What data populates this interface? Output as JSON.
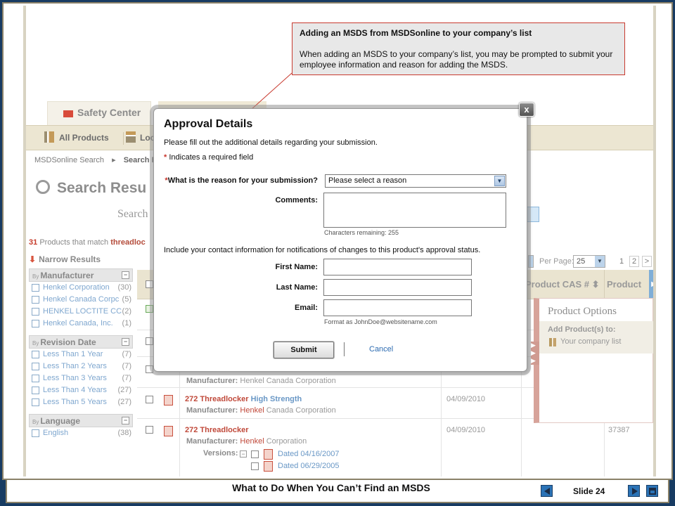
{
  "callout": {
    "title": "Adding an MSDS from MSDSonline to your company’s list",
    "body": "When adding an MSDS to your company’s list, you may be prompted to submit your employee information and reason  for adding the MSDS."
  },
  "site": {
    "safety_center_label": "Safety Center",
    "nav_all_products": "All Products",
    "nav_loc_partial": "Loc",
    "breadcrumb_first": "MSDSonline Search",
    "breadcrumb_second": "Search R",
    "search_title": "Search Resu",
    "search_sub": "Search",
    "result_count": "31",
    "result_text": "Products that match",
    "result_term": "threadloc",
    "narrow_results": "Narrow Results"
  },
  "filters": {
    "manufacturer": {
      "by": "By",
      "title": "Manufacturer",
      "items": [
        {
          "label": "Henkel Corporation",
          "count": "(30)"
        },
        {
          "label": "Henkel Canada Corpc",
          "count": "(5)"
        },
        {
          "label": "HENKEL LOCTITE CC",
          "count": "(2)"
        },
        {
          "label": "Henkel Canada, Inc.",
          "count": "(1)"
        }
      ]
    },
    "revision": {
      "by": "By",
      "title": "Revision Date",
      "items": [
        {
          "label": "Less Than 1 Year",
          "count": "(7)"
        },
        {
          "label": "Less Than 2 Years",
          "count": "(7)"
        },
        {
          "label": "Less Than 3 Years",
          "count": "(7)"
        },
        {
          "label": "Less Than 4 Years",
          "count": "(27)"
        },
        {
          "label": "Less Than 5 Years",
          "count": "(27)"
        }
      ]
    },
    "language": {
      "by": "By",
      "title": "Language",
      "items": [
        {
          "label": "English",
          "count": "(38)"
        }
      ]
    }
  },
  "table": {
    "col_cas": "Product CAS #",
    "col_product": "Product",
    "per_page_label": "Per Page:",
    "per_page_value": "25",
    "page_current": "1",
    "page_next": "2",
    "page_more": ">",
    "rows": [
      {
        "title": "272 Threadlocker",
        "title_suffix": "High Strength",
        "mfr_label": "Manufacturer:",
        "mfr_red": "Henkel",
        "mfr_rest": "Canada Corporation",
        "date": "04/09/2010",
        "cas": ""
      },
      {
        "title": "272 Threadlocker",
        "title_suffix": "",
        "mfr_label": "Manufacturer:",
        "mfr_red": "Henkel",
        "mfr_rest": "Corporation",
        "date": "04/09/2010",
        "cas": "37387"
      }
    ],
    "partial_mfr": "Manufacturer:",
    "partial_mfr_value": "Henkel Canada Corporation",
    "versions_label": "Versions:",
    "versions": [
      "Dated 04/16/2007",
      "Dated 06/29/2005"
    ]
  },
  "product_options": {
    "title": "Product Options",
    "add_to": "Add Product(s) to:",
    "company_list": "Your company list"
  },
  "modal": {
    "title": "Approval Details",
    "description": "Please fill out the additional details regarding your submission.",
    "required_star": "*",
    "required_text": "Indicates a required field",
    "reason_label": "What is the reason for your submission?",
    "reason_value": "Please select a reason",
    "comments_label": "Comments:",
    "chars_remaining": "Characters remaining: 255",
    "contact_text": "Include your contact information for notifications of changes to this product's approval status.",
    "first_name_label": "First Name:",
    "last_name_label": "Last Name:",
    "email_label": "Email:",
    "email_hint": "Format as JohnDoe@websitename.com",
    "submit_label": "Submit",
    "cancel_label": "Cancel",
    "close_label": "x"
  },
  "footer": {
    "title": "What to Do When You Can’t Find an MSDS",
    "slide_label": "Slide 24"
  },
  "colors": {
    "slide_background": "#173b62",
    "callout_border": "#c83a2f",
    "link": "#2c6bb1",
    "required": "#c8352b"
  }
}
